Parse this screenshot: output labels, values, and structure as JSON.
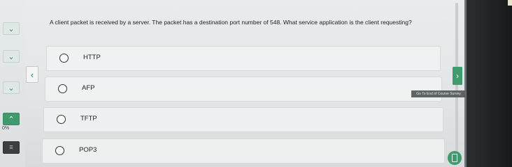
{
  "question": {
    "text": "A client packet is received by a server. The packet has a destination port number of 548. What service application is the client requesting?"
  },
  "options": [
    {
      "label": "HTTP"
    },
    {
      "label": "AFP"
    },
    {
      "label": "TFTP"
    },
    {
      "label": "POP3"
    }
  ],
  "sidebar": {
    "progress": "0%",
    "buttons": [
      {
        "icon": "chevron-down-icon"
      },
      {
        "icon": "chevron-down-icon"
      },
      {
        "icon": "chevron-down-icon"
      },
      {
        "icon": "chevron-up-icon"
      },
      {
        "icon": "transcript-icon"
      }
    ]
  },
  "navigation": {
    "prev_icon": "chevron-left-icon",
    "next_icon": "chevron-right-icon",
    "end_course_label": "Go To End of Course Survey"
  },
  "colors": {
    "accent": "#3f9a6d",
    "background": "#e6e9e9",
    "dark_panel": "#1c2021"
  }
}
